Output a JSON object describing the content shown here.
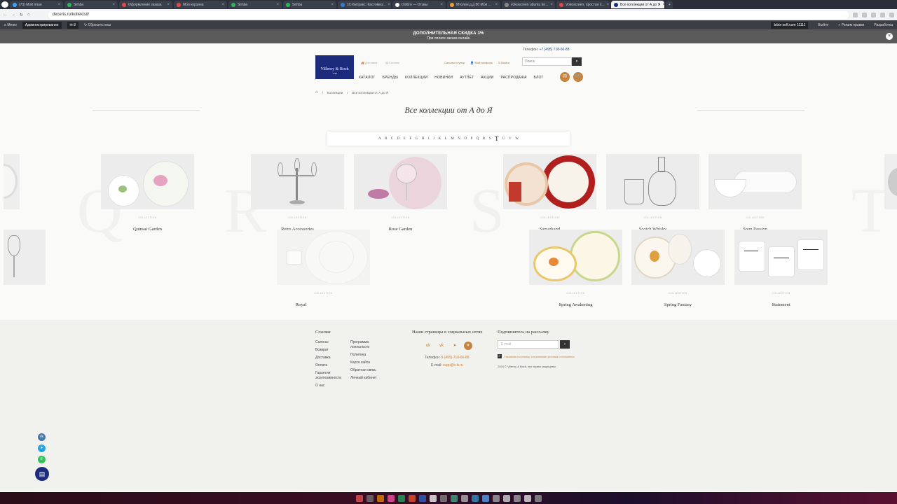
{
  "browser": {
    "tabs": [
      {
        "label": "(73) Мой план",
        "color": "#3ea6ff"
      },
      {
        "label": "Simba",
        "color": "#2fb55b"
      },
      {
        "label": "Оформление заказа",
        "color": "#e04a4a"
      },
      {
        "label": "Моя корзина",
        "color": "#e04a4a"
      },
      {
        "label": "Simba",
        "color": "#2fb55b"
      },
      {
        "label": "Simba",
        "color": "#2fb55b"
      },
      {
        "label": "1С-Битрикс: Кастомиз...",
        "color": "#3a7bd5"
      },
      {
        "label": "Dolbro — Отзвы",
        "color": "#ffffff"
      },
      {
        "label": "Мтолин.д.д 80 Мои ...",
        "color": "#f0a030"
      },
      {
        "label": "vokoscreen ubuntu ter...",
        "color": "#888888"
      },
      {
        "label": "Vokoscreen, простая п...",
        "color": "#e04a4a"
      },
      {
        "label": "Все коллекции от А до Я",
        "color": "#1c2b7c",
        "active": true
      }
    ],
    "url": "deceris.ru/kollektsii/"
  },
  "admin": {
    "menu": "Меню",
    "admin_label": "Администрирование",
    "count": "8",
    "clear_cache": "Сбросить кеш",
    "site": "bitrix-soft.com 11111",
    "logout": "Выйти",
    "edit_mode": "Режим правки",
    "dev": "Разработка"
  },
  "promo": {
    "line1": "ДОПОЛНИТЕЛЬНАЯ СКИДКА 3%",
    "line2": "При оплате заказа онлайн"
  },
  "header": {
    "phone_label": "Телефон:",
    "phone": "+7 (495) 718-66-88",
    "logo_name": "Villeroy & Boch",
    "logo_year": "1748",
    "delivery": "Доставка",
    "salons": "Салоны",
    "compare": "Салоны Ьтутыр",
    "profile": "Мой профиль",
    "logout": "Выйти",
    "search_placeholder": "Поиск"
  },
  "nav": [
    "КАТАЛОГ",
    "БРЕНДЫ",
    "КОЛЛЕКЦИИ",
    "НОВИНКИ",
    "АУТЛЕТ",
    "АКЦИИ",
    "РАСПРОДАЖА",
    "БЛОГ"
  ],
  "breadcrumb": {
    "home": "Главная",
    "c1": "Коллекции",
    "c2": "Все коллекции от А до Я"
  },
  "page_title": "Все коллекции от А до Я",
  "alphabet": [
    "A",
    "B",
    "C",
    "D",
    "E",
    "F",
    "G",
    "H",
    "I",
    "J",
    "K",
    "L",
    "M",
    "N",
    "O",
    "P",
    "Q",
    "R",
    "S",
    "T",
    "U",
    "V",
    "W"
  ],
  "current_letter": "T",
  "bg_letters": [
    "Q",
    "R",
    "S",
    "T"
  ],
  "collection_tag": "COLLECTION",
  "collections_row1": [
    {
      "name": "Quinsai Garden"
    },
    {
      "name": "Retro Accessories"
    },
    {
      "name": "Rose Garden"
    },
    {
      "name": "Samarkand"
    },
    {
      "name": "Scotch Whisky"
    },
    {
      "name": "Soup Passion"
    }
  ],
  "collections_row2": [
    {
      "name": "Royal"
    },
    {
      "name": "Spring Awakening"
    },
    {
      "name": "Spring Fantasy"
    },
    {
      "name": "Statement"
    }
  ],
  "footer": {
    "links_title": "Ссылки",
    "links_col1": [
      "Салоны",
      "Возврат",
      "Доставка",
      "Оплата",
      "Гарантии эксклюзивности",
      "О нас"
    ],
    "links_col2": [
      "Программа лояльности",
      "Политика",
      "Карта сайта",
      "Обратная связь",
      "Личный кабинет"
    ],
    "social_title": "Наши страницы в социальных сетях",
    "phone_label": "Телефон:",
    "phone": "8 (495) 718-66-88",
    "email_label": "E-mail:",
    "email": "supp@v-b.ru",
    "newsletter_title": "Подпишитесь на рассылку",
    "email_placeholder": "E-mail",
    "consent": "Нажимая на кнопку, я принимаю условия соглашения",
    "copyright": "2024 © Villeroy & Boch, все права защищены."
  },
  "colors": {
    "accent": "#c8843e",
    "brand": "#1c2b7c"
  }
}
